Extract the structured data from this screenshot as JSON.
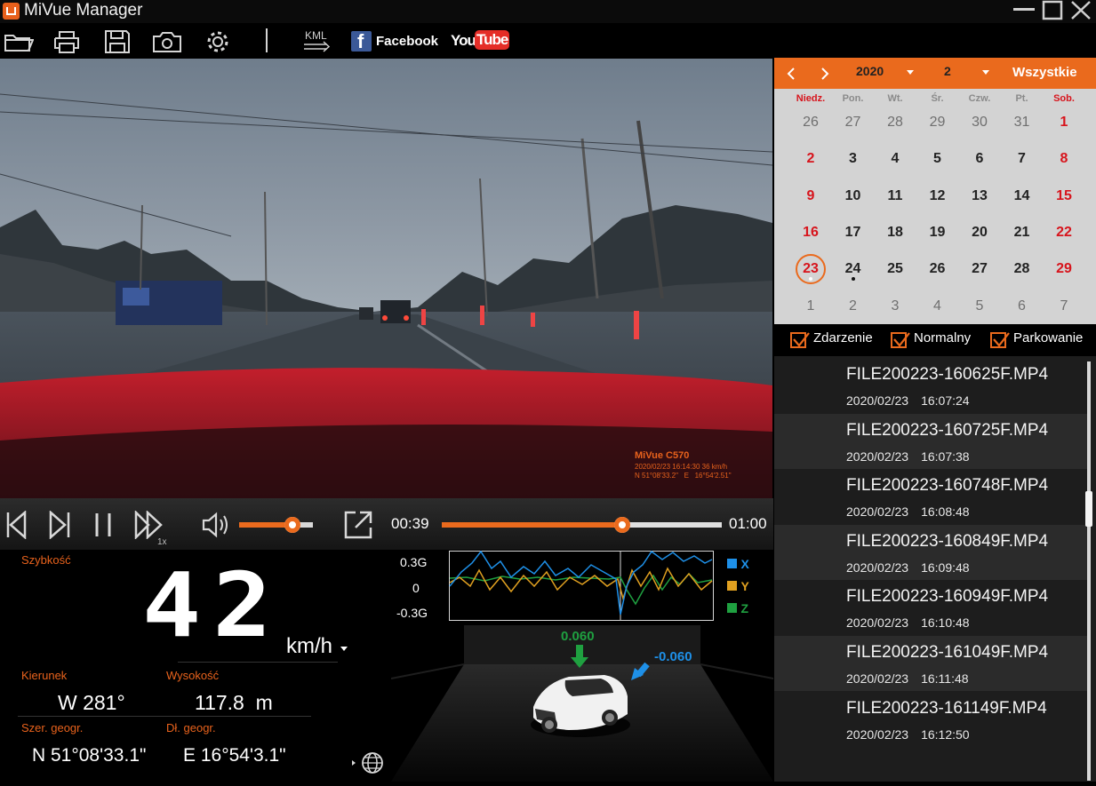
{
  "app": {
    "title": "MiVue Manager"
  },
  "toolbar": {
    "kml_label": "KML",
    "facebook_label": "Facebook",
    "youtube_you": "You",
    "youtube_tube": "Tube"
  },
  "video": {
    "model": "MiVue C570",
    "overlay_line1": "2020/02/23 16:14:30 36 km/h",
    "overlay_line2": "N 51°08'33.2\"   E   16°54'2.51\""
  },
  "player": {
    "speed_label": "1x",
    "current_time": "00:39",
    "total_time": "01:00",
    "progress": 0.645,
    "volume": 0.72
  },
  "info": {
    "speed_label": "Szybkość",
    "speed_value": "42",
    "speed_unit": "km/h",
    "direction_label": "Kierunek",
    "direction_value": "W 281°",
    "altitude_label": "Wysokość",
    "altitude_value": "117.8  m",
    "lat_label": "Szer. geogr.",
    "lat_value": "N 51°08'33.1\"",
    "lon_label": "Dł. geogr.",
    "lon_value": "E 16°54'3.1\""
  },
  "gsensor": {
    "ticks": [
      "0.3G",
      "0",
      "-0.3G"
    ],
    "legend": [
      {
        "label": "X",
        "color": "#1e90e8"
      },
      {
        "label": "Y",
        "color": "#e0a020"
      },
      {
        "label": "Z",
        "color": "#1fa040"
      }
    ],
    "car_value_z": "0.060",
    "car_value_x": "-0.060"
  },
  "calendar": {
    "year": "2020",
    "month": "2",
    "filter_all": "Wszystkie",
    "weekdays": [
      "Niedz.",
      "Pon.",
      "Wt.",
      "Śr.",
      "Czw.",
      "Pt.",
      "Sob."
    ],
    "weeks": [
      [
        "26",
        "27",
        "28",
        "29",
        "30",
        "31",
        "1"
      ],
      [
        "2",
        "3",
        "4",
        "5",
        "6",
        "7",
        "8"
      ],
      [
        "9",
        "10",
        "11",
        "12",
        "13",
        "14",
        "15"
      ],
      [
        "16",
        "17",
        "18",
        "19",
        "20",
        "21",
        "22"
      ],
      [
        "23",
        "24",
        "25",
        "26",
        "27",
        "28",
        "29"
      ],
      [
        "1",
        "2",
        "3",
        "4",
        "5",
        "6",
        "7"
      ]
    ],
    "selected_day": "23",
    "colors": {
      "accent": "#ea6a1d",
      "weekend": "#d7141c",
      "muted": "#6f6f6f"
    }
  },
  "filters": [
    {
      "label": "Zdarzenie",
      "checked": true
    },
    {
      "label": "Normalny",
      "checked": true
    },
    {
      "label": "Parkowanie",
      "checked": true
    }
  ],
  "files": [
    {
      "name": "FILE200223-160625F.MP4",
      "date": "2020/02/23",
      "time": "16:07:24"
    },
    {
      "name": "FILE200223-160725F.MP4",
      "date": "2020/02/23",
      "time": "16:07:38"
    },
    {
      "name": "FILE200223-160748F.MP4",
      "date": "2020/02/23",
      "time": "16:08:48"
    },
    {
      "name": "FILE200223-160849F.MP4",
      "date": "2020/02/23",
      "time": "16:09:48"
    },
    {
      "name": "FILE200223-160949F.MP4",
      "date": "2020/02/23",
      "time": "16:10:48"
    },
    {
      "name": "FILE200223-161049F.MP4",
      "date": "2020/02/23",
      "time": "16:11:48"
    },
    {
      "name": "FILE200223-161149F.MP4",
      "date": "2020/02/23",
      "time": "16:12:50"
    }
  ]
}
